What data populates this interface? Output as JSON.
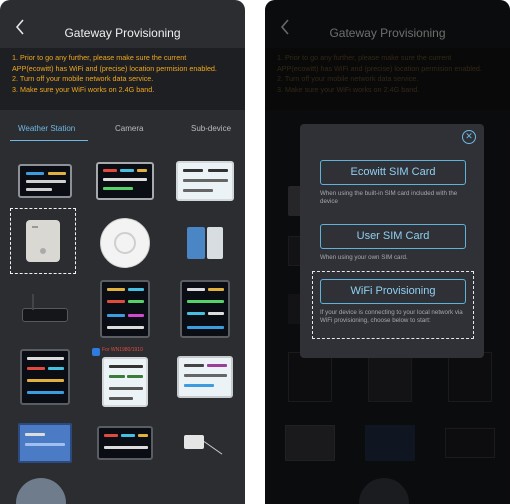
{
  "header": {
    "title": "Gateway Provisioning"
  },
  "notice": {
    "lines": [
      "1. Prior to go any further, please make sure the current",
      "APP(ecowitt) has WiFi and (precise) location permision enabled.",
      "2. Turn off your mobile network data service.",
      "3. Make sure your WiFi works on 2.4G band."
    ]
  },
  "tabs": [
    {
      "label": "Weather Station",
      "active": true
    },
    {
      "label": "Camera",
      "active": false
    },
    {
      "label": "Sub-device",
      "active": false
    }
  ],
  "product_badge": "For WN1980/1910",
  "modal": {
    "options": [
      {
        "label": "Ecowitt SIM Card",
        "description": "When using the built-in SIM card included with the device"
      },
      {
        "label": "User SIM Card",
        "description": "When using your own SIM card."
      },
      {
        "label": "WiFi Provisioning",
        "description": "If your device is connecting to your local network via WiFi provisioning, choose below to start:"
      }
    ]
  },
  "colors": {
    "accent": "#6fb8e6",
    "warning": "#f0a81c",
    "background": "#2b2d31"
  }
}
